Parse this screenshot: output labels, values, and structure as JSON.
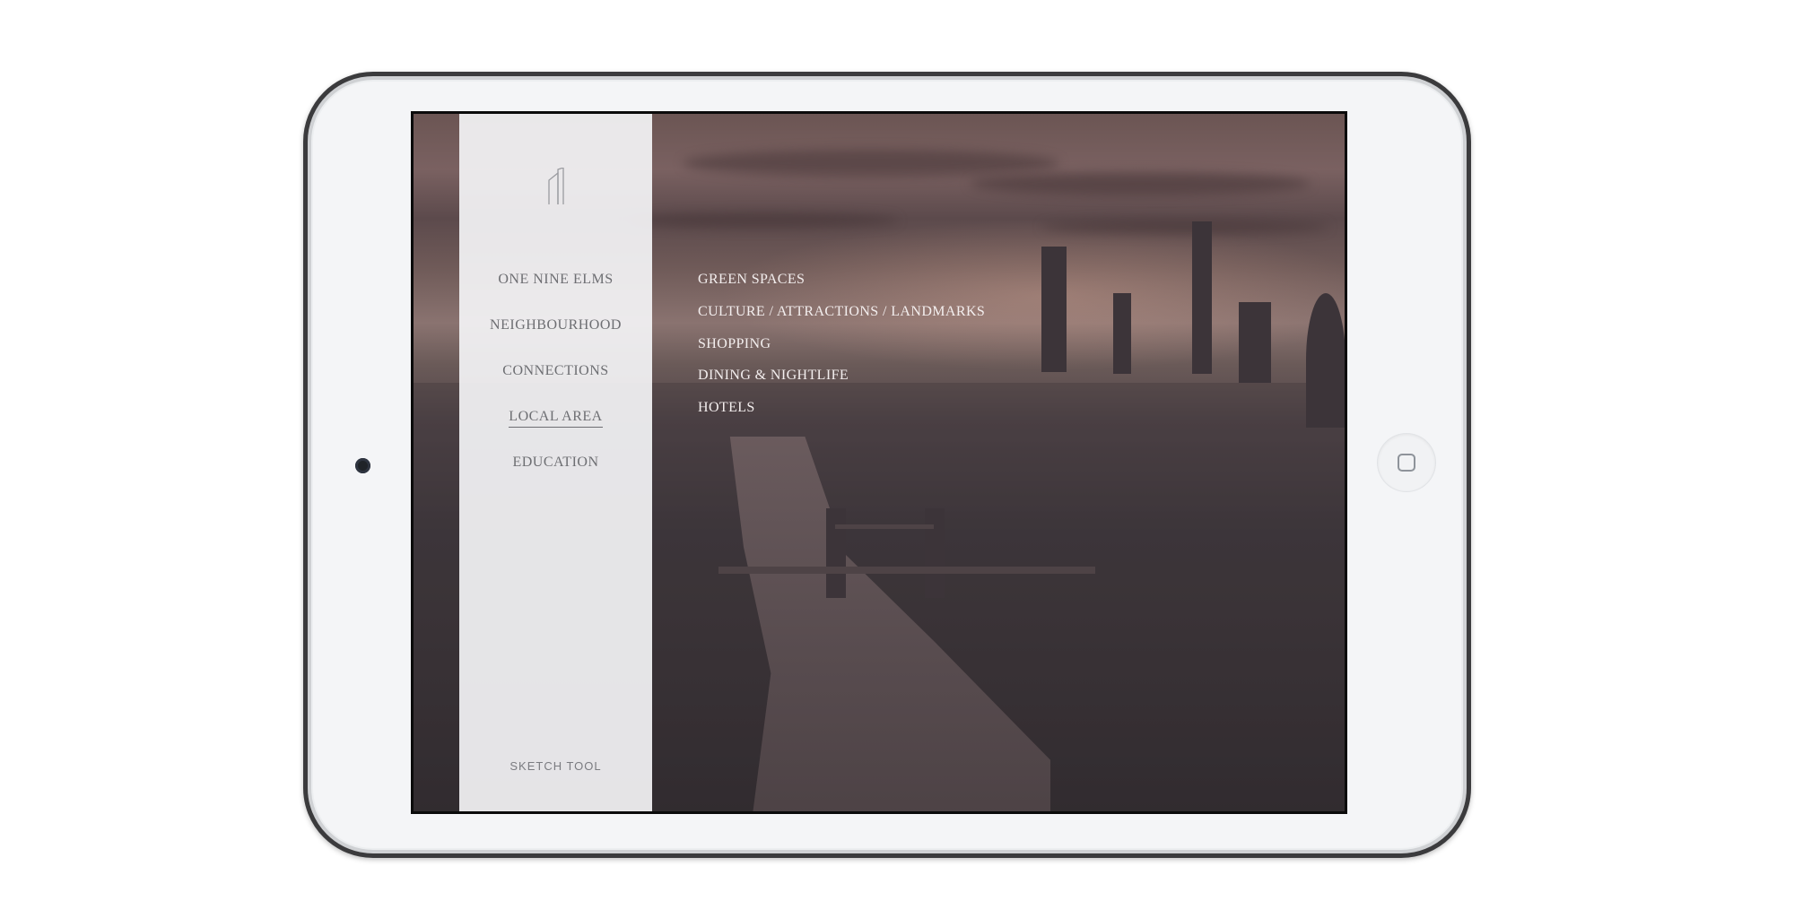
{
  "sidebar": {
    "nav": [
      {
        "label": "ONE NINE ELMS",
        "active": false
      },
      {
        "label": "NEIGHBOURHOOD",
        "active": false
      },
      {
        "label": "CONNECTIONS",
        "active": false
      },
      {
        "label": "LOCAL AREA",
        "active": true
      },
      {
        "label": "EDUCATION",
        "active": false
      }
    ],
    "sketch_tool_label": "SKETCH TOOL",
    "logo_icon": "tower-logo-icon"
  },
  "submenu": [
    "GREEN SPACES",
    "CULTURE / ATTRACTIONS / LANDMARKS",
    "SHOPPING",
    "DINING & NIGHTLIFE",
    "HOTELS"
  ],
  "colors": {
    "sidebar_bg": "#f4f4f6",
    "nav_text": "#6d6e72",
    "submenu_text": "#f3eeee",
    "device_frame": "#f4f5f7"
  }
}
